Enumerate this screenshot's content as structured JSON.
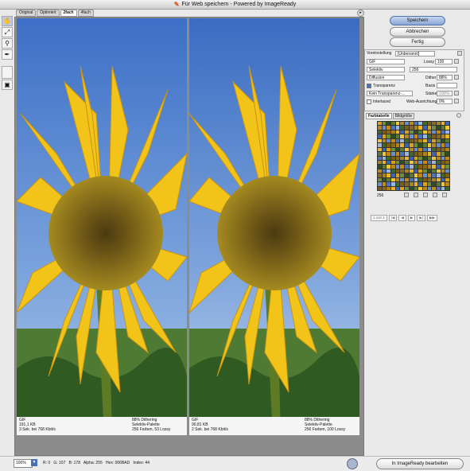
{
  "window": {
    "title": "Für Web speichern - Powered by ImageReady"
  },
  "tabs": [
    "Original",
    "Optimiert",
    "2fach",
    "4fach"
  ],
  "active_tab": 2,
  "panes": [
    {
      "format": "GIF",
      "size": "191,1 KB",
      "time": "3 Sek. bei 768 Kbit/s",
      "dither": "88% Dithering",
      "palette": "Selektiv-Palette",
      "colors": "256 Farben, 53 Lossy"
    },
    {
      "format": "GIF",
      "size": "90,81 KB",
      "time": "2 Sek. bei 768 Kbit/s",
      "dither": "88% Dithering",
      "palette": "Selektiv-Palette",
      "colors": "256 Farben, 100 Lossy"
    }
  ],
  "buttons": {
    "save": "Speichern",
    "cancel": "Abbrechen",
    "done": "Fertig",
    "edit_imageready": "In ImageReady bearbeiten"
  },
  "settings": {
    "preset_label": "Voreinstellung",
    "preset_value": "[Unbenannt]",
    "format": "GIF",
    "lossy_label": "Lossy",
    "lossy_value": "100",
    "reduction": "Selektiv",
    "colors_value": "256",
    "dither_algo": "Diffusion",
    "dither_label": "Dither",
    "dither_value": "88%",
    "transparency_label": "Transparenz",
    "basis_label": "Basis",
    "matte": "Kein Transparenz-...",
    "strength_label": "Stärke",
    "strength_value": "100%",
    "interlaced_label": "Interlaced",
    "web_snap_label": "Web-Ausrichtung",
    "web_snap_value": "0%"
  },
  "color_panel": {
    "tab_color_table": "Farbtabelle",
    "tab_image_size": "Bildgröße",
    "count": "256"
  },
  "nav": {
    "page": "1 von 1"
  },
  "status": {
    "zoom": "100%",
    "pixel_info": "R: 0   G: 107   B: 178   Alpha: 255   Hex: 006BAD   Index: 44"
  },
  "colors": {
    "accent": "#4b70b3",
    "sky": "#4a78c8",
    "petal": "#f2c41a",
    "leaf": "#3f6b2a"
  }
}
